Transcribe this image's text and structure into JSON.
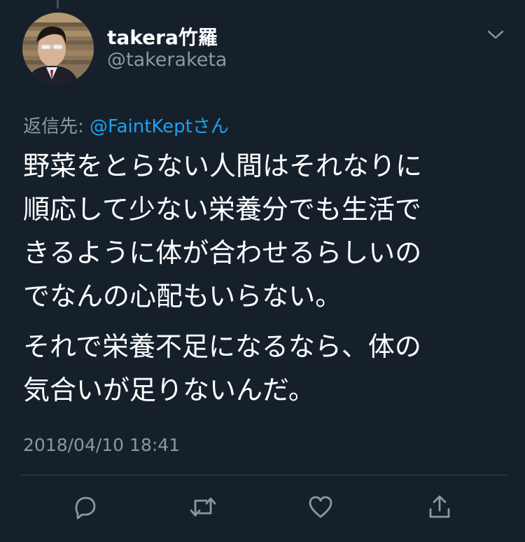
{
  "user": {
    "display_name": "takera竹羅",
    "handle": "@takeraketa"
  },
  "reply": {
    "prefix": "返信先: ",
    "mention": "@FaintKeptさん"
  },
  "tweet": {
    "lines_paragraph_1": [
      "野菜をとらない人間はそれなりに",
      "順応して少ない栄養分でも生活で",
      "きるように体が合わせるらしいの",
      "でなんの心配もいらない。"
    ],
    "lines_paragraph_2": [
      "それで栄養不足になるなら、体の",
      "気合いが足りないんだ。"
    ]
  },
  "timestamp": "2018/04/10 18:41",
  "actions": {
    "reply_icon": "reply-bubble-icon",
    "retweet_icon": "retweet-icon",
    "like_icon": "heart-icon",
    "share_icon": "share-icon"
  },
  "colors": {
    "background": "#15202b",
    "text_primary": "#ffffff",
    "text_secondary": "#8899a6",
    "accent": "#1da1f2",
    "divider": "#38444d"
  }
}
